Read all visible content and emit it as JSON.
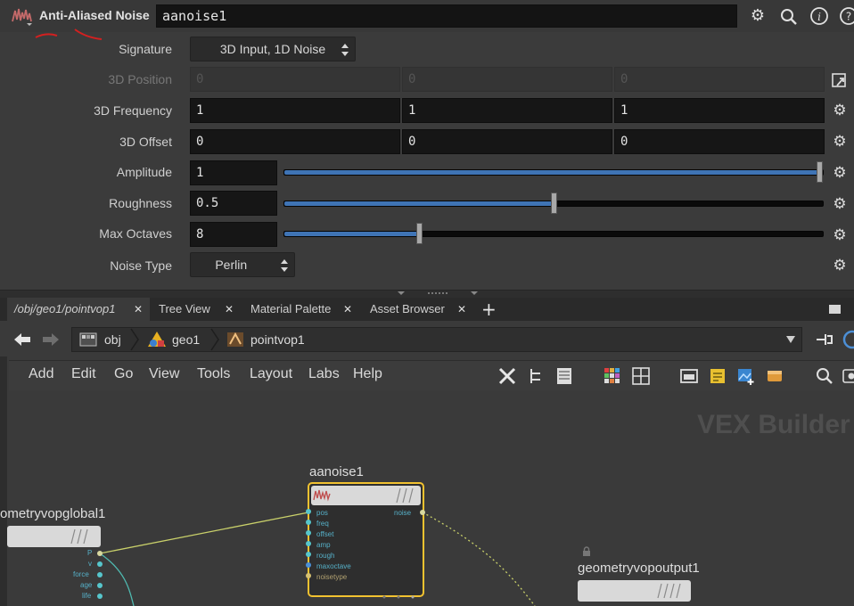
{
  "header": {
    "node_type": "Anti-Aliased Noise",
    "node_name": "aanoise1",
    "icons": [
      "gear-icon",
      "search-icon",
      "info-icon",
      "help-icon"
    ]
  },
  "params": {
    "signature": {
      "label": "Signature",
      "value": "3D Input, 1D Noise"
    },
    "position": {
      "label": "3D Position",
      "values": [
        "0",
        "0",
        "0"
      ]
    },
    "frequency": {
      "label": "3D Frequency",
      "values": [
        "1",
        "1",
        "1"
      ]
    },
    "offset": {
      "label": "3D Offset",
      "values": [
        "0",
        "0",
        "0"
      ]
    },
    "amplitude": {
      "label": "Amplitude",
      "value": "1",
      "slider_fraction": 1.0
    },
    "roughness": {
      "label": "Roughness",
      "value": "0.5",
      "slider_fraction": 0.5
    },
    "max_octaves": {
      "label": "Max Octaves",
      "value": "8",
      "slider_fraction": 0.25
    },
    "noise_type": {
      "label": "Noise Type",
      "value": "Perlin"
    }
  },
  "tabs": [
    {
      "label": "/obj/geo1/pointvop1",
      "active": true
    },
    {
      "label": "Tree View",
      "active": false
    },
    {
      "label": "Material Palette",
      "active": false
    },
    {
      "label": "Asset Browser",
      "active": false
    }
  ],
  "path": {
    "items": [
      "obj",
      "geo1",
      "pointvop1"
    ]
  },
  "menu": [
    "Add",
    "Edit",
    "Go",
    "View",
    "Tools",
    "Layout",
    "Labs",
    "Help"
  ],
  "network": {
    "watermark": "VEX Builder",
    "nodes": {
      "aanoise": {
        "name": "aanoise1",
        "inputs": [
          "pos",
          "freq",
          "offset",
          "amp",
          "rough",
          "maxoctave",
          "noisetype"
        ],
        "output": "noise"
      },
      "global": {
        "name": "ometryvopglobal1",
        "outputs": [
          "P",
          "v",
          "force",
          "age",
          "life"
        ]
      },
      "output": {
        "name": "geometryvopoutput1"
      }
    }
  },
  "colors": {
    "slider_fill": "#3f74b5",
    "node_selected": "#f2c230",
    "wire": "#c9d06a"
  }
}
